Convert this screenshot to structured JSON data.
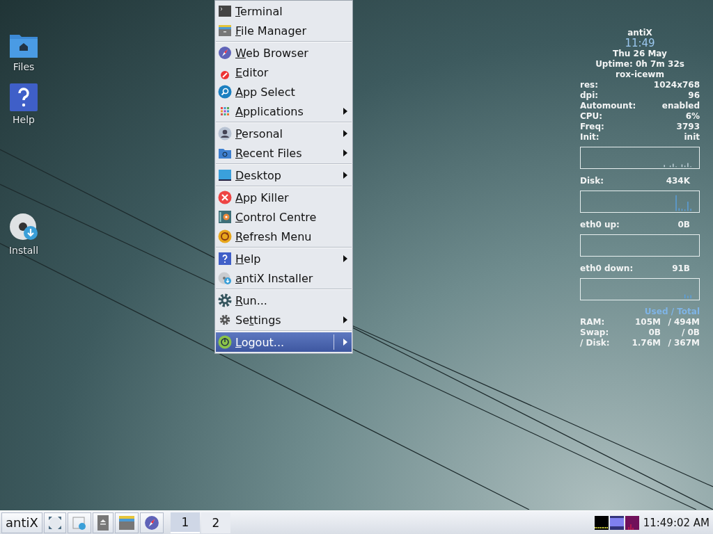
{
  "desktop_icons": [
    {
      "label": "Files"
    },
    {
      "label": "Help"
    },
    {
      "label": "Install"
    }
  ],
  "menu": {
    "groups": [
      [
        {
          "mnemonic": "T",
          "rest": "erminal",
          "submenu": false,
          "selected": false
        },
        {
          "mnemonic": "F",
          "rest": "ile Manager",
          "submenu": false,
          "selected": false
        }
      ],
      [
        {
          "mnemonic": "W",
          "rest": "eb Browser",
          "submenu": false,
          "selected": false
        },
        {
          "mnemonic": "E",
          "rest": "ditor",
          "submenu": false,
          "selected": false
        },
        {
          "mnemonic": "A",
          "rest": "pp Select",
          "submenu": false,
          "selected": false
        },
        {
          "mnemonic": "A",
          "rest": "pplications",
          "submenu": true,
          "selected": false
        }
      ],
      [
        {
          "mnemonic": "P",
          "rest": "ersonal",
          "submenu": true,
          "selected": false
        },
        {
          "mnemonic": "R",
          "rest": "ecent Files",
          "submenu": true,
          "selected": false
        }
      ],
      [
        {
          "mnemonic": "D",
          "rest": "esktop",
          "submenu": true,
          "selected": false
        }
      ],
      [
        {
          "mnemonic": "A",
          "rest": "pp Killer",
          "submenu": false,
          "selected": false
        },
        {
          "mnemonic": "C",
          "rest": "ontrol Centre",
          "submenu": false,
          "selected": false
        },
        {
          "mnemonic": "R",
          "rest": "efresh Menu",
          "submenu": false,
          "selected": false
        }
      ],
      [
        {
          "mnemonic": "H",
          "rest": "elp",
          "submenu": true,
          "selected": false
        },
        {
          "mnemonic": "a",
          "rest": "ntiX Installer",
          "submenu": false,
          "selected": false
        }
      ],
      [
        {
          "mnemonic": "R",
          "rest": "un...",
          "submenu": false,
          "selected": false
        },
        {
          "before": "Se",
          "mnemonic": "t",
          "rest": "tings",
          "submenu": true,
          "selected": false
        }
      ],
      [
        {
          "mnemonic": "L",
          "rest": "ogout...",
          "submenu": true,
          "selected": true
        }
      ]
    ]
  },
  "conky": {
    "title": "antiX",
    "time": "11:49",
    "date": "Thu 26 May",
    "uptime": "Uptime: 0h 7m 32s",
    "session": "rox-icewm",
    "stats": [
      {
        "label": "res:",
        "value": "1024x768"
      },
      {
        "label": "dpi:",
        "value": "96"
      },
      {
        "label": "Automount:",
        "value": "enabled"
      },
      {
        "label": "CPU:",
        "value": "6%"
      },
      {
        "label": "Freq:",
        "value": "3793"
      },
      {
        "label": "Init:",
        "value": "init"
      }
    ],
    "graphs": [
      {
        "label": "Disk:",
        "value": "434K"
      },
      {
        "label": "eth0 up:",
        "value": "0B"
      },
      {
        "label": "eth0 down:",
        "value": "91B"
      }
    ],
    "usage_header": "Used / Total",
    "usage": [
      {
        "label": "RAM:",
        "used": "105M",
        "total": "/ 494M"
      },
      {
        "label": "Swap:",
        "used": "0B",
        "total": "/ 0B"
      },
      {
        "label": "/ Disk:",
        "used": "1.76M",
        "total": "/ 367M"
      }
    ]
  },
  "taskbar": {
    "start": "antiX",
    "workspaces": [
      {
        "label": "1",
        "selected": true
      },
      {
        "label": "2",
        "selected": false
      }
    ],
    "clock": "11:49:02 AM"
  }
}
